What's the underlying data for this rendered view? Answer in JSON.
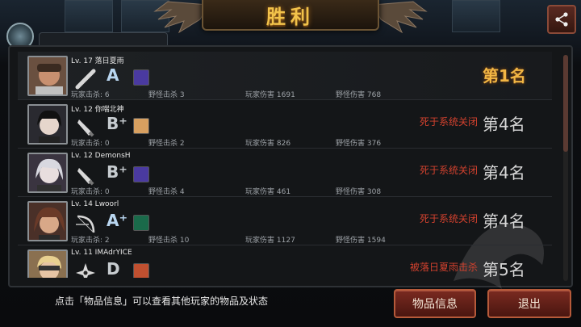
{
  "header": {
    "title": "胜利"
  },
  "hint": "点击「物品信息」可以查看其他玩家的物品及状态",
  "buttons": {
    "item_info": "物品信息",
    "exit": "退出"
  },
  "labels": {
    "player_kills": "玩家击杀:",
    "monster_kills": "野怪击杀",
    "player_damage": "玩家伤害",
    "monster_damage": "野怪伤害"
  },
  "players": [
    {
      "name": "Lv. 17 落日夏雨",
      "weapon": "bat-icon",
      "grade": "A",
      "player_kills": "6",
      "monster_kills": "3",
      "player_damage": "1691",
      "monster_damage": "768",
      "death": "",
      "rank": "第1名"
    },
    {
      "name": "Lv. 12 你喘北神",
      "weapon": "knife-icon",
      "grade": "B⁺",
      "player_kills": "0",
      "monster_kills": "2",
      "player_damage": "826",
      "monster_damage": "376",
      "death": "死于系统关闭",
      "rank": "第4名"
    },
    {
      "name": "Lv. 12 DemonsH",
      "weapon": "knife-icon",
      "grade": "B⁺",
      "player_kills": "0",
      "monster_kills": "4",
      "player_damage": "461",
      "monster_damage": "308",
      "death": "死于系统关闭",
      "rank": "第4名"
    },
    {
      "name": "Lv. 14 Lwoorl",
      "weapon": "bow-icon",
      "grade": "A⁺",
      "player_kills": "2",
      "monster_kills": "10",
      "player_damage": "1127",
      "monster_damage": "1594",
      "death": "死于系统关闭",
      "rank": "第4名"
    },
    {
      "name": "Lv. 11 IMAdrYICE",
      "weapon": "shuriken-icon",
      "grade": "D",
      "player_kills": "",
      "monster_kills": "",
      "player_damage": "",
      "monster_damage": "",
      "death": "被落日夏雨击杀",
      "rank": "第5名"
    }
  ],
  "colors": {
    "gold": "#f2b644",
    "death_red": "#d1412e",
    "button_red": "#7a2a20"
  }
}
